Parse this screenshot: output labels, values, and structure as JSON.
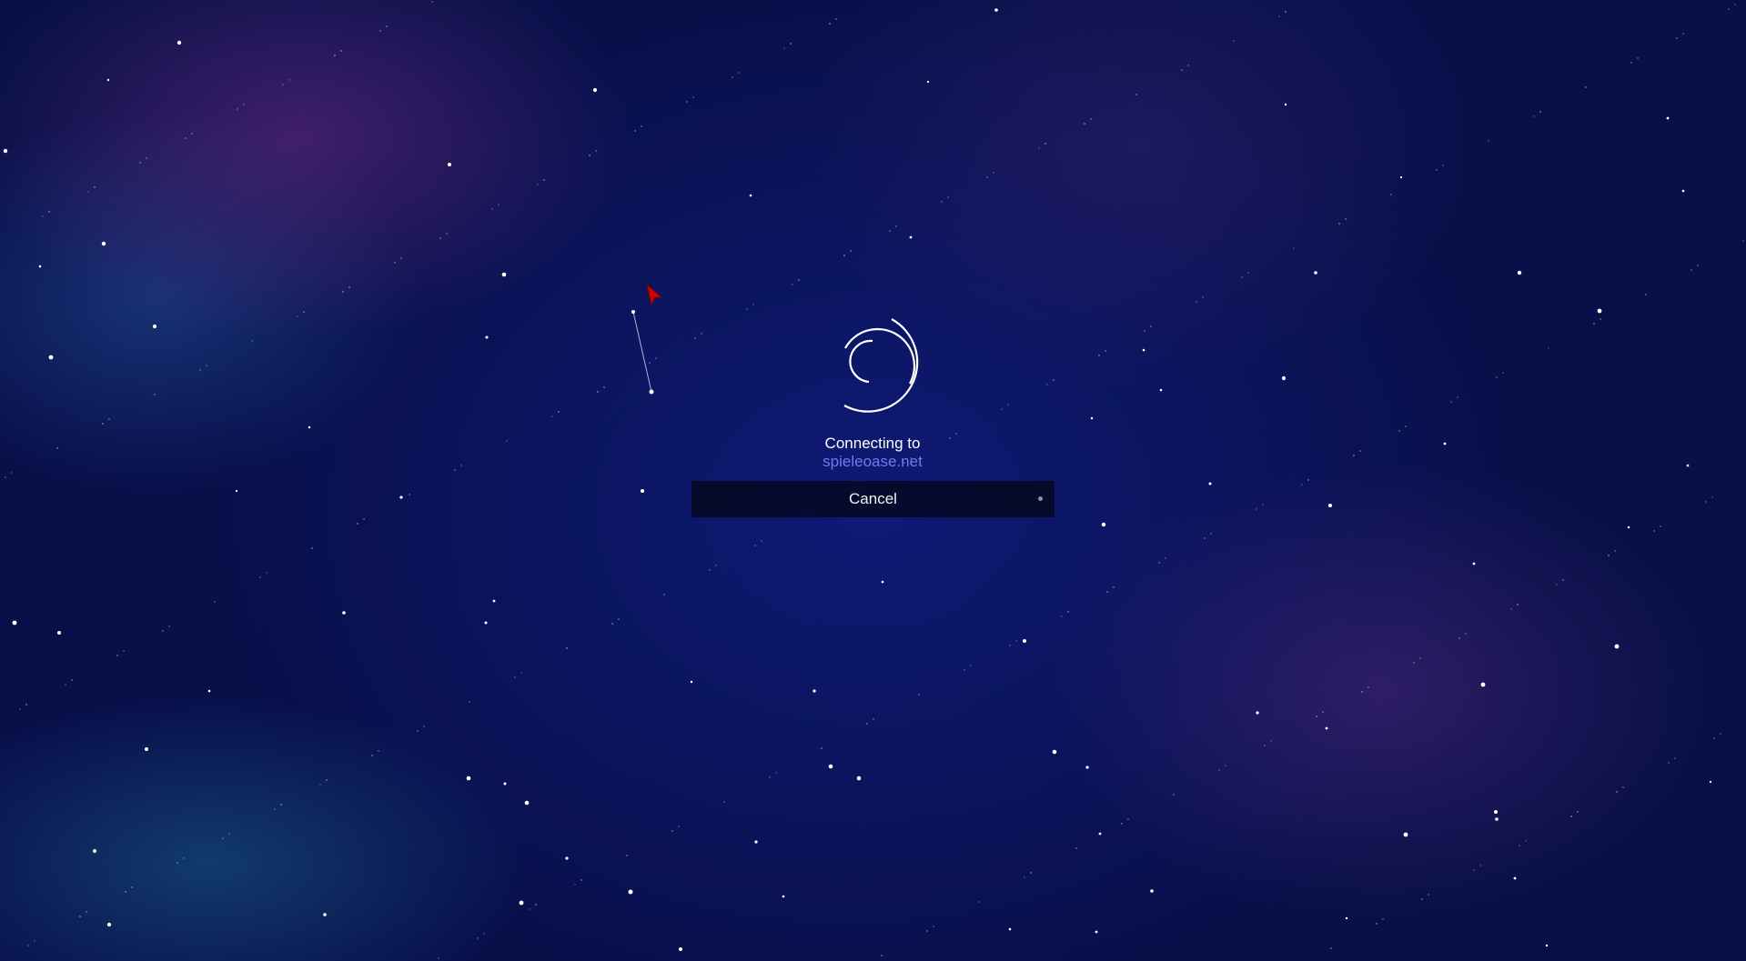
{
  "connection": {
    "status_label": "Connecting to",
    "host": "spieleoase.net"
  },
  "dialog": {
    "cancel_label": "Cancel"
  },
  "icons": {
    "loader": "loading-spinner-icon",
    "cursor": "mouse-cursor-icon",
    "cancel_indicator": "dot-icon"
  },
  "colors": {
    "background": "#0b1a66",
    "host_link": "#6e7cf0",
    "button_background": "#05081e",
    "cursor": "#d40000",
    "text": "#ffffff"
  }
}
